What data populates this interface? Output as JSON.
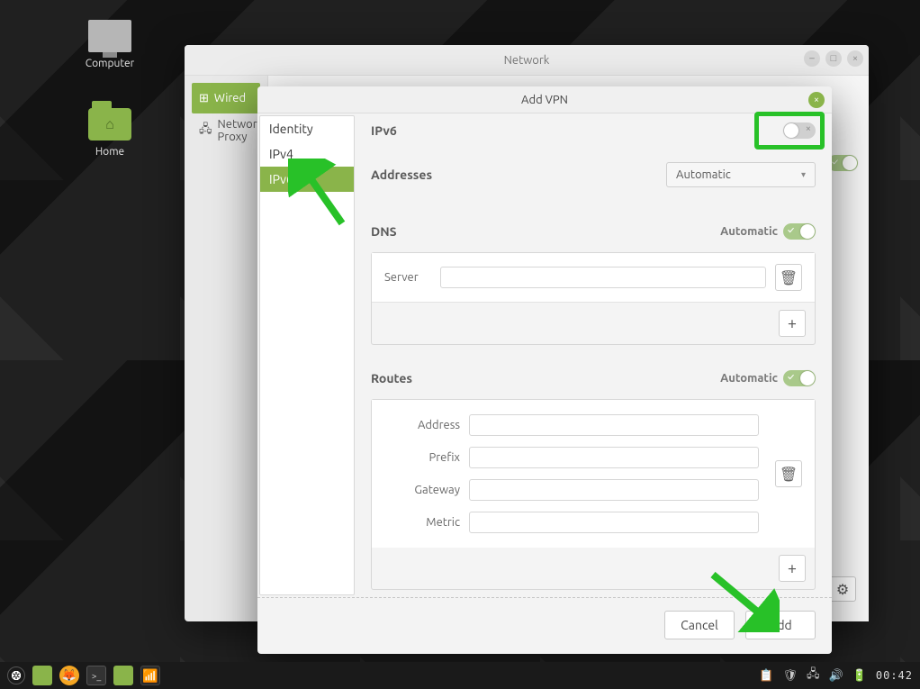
{
  "desktop": {
    "icons": {
      "computer": "Computer",
      "home": "Home"
    }
  },
  "network_window": {
    "title": "Network",
    "sidebar": {
      "wired": {
        "label": "Wired",
        "icon": "network-wired-icon"
      },
      "proxy": {
        "label": "Network Proxy",
        "icon": "network-proxy-icon"
      }
    },
    "add_button": "+",
    "remove_button": "−",
    "gear_button": "⚙"
  },
  "vpn_dialog": {
    "title": "Add VPN",
    "tabs": {
      "identity": "Identity",
      "ipv4": "IPv4",
      "ipv6": "IPv6"
    },
    "selected_tab": "ipv6",
    "ipv6": {
      "heading": "IPv6",
      "enabled": false,
      "addresses": {
        "label": "Addresses",
        "mode": "Automatic"
      },
      "dns": {
        "label": "DNS",
        "automatic_label": "Automatic",
        "automatic": true,
        "server_label": "Server",
        "server_value": "",
        "add": "+"
      },
      "routes": {
        "label": "Routes",
        "automatic_label": "Automatic",
        "automatic": true,
        "fields": {
          "address": "Address",
          "prefix": "Prefix",
          "gateway": "Gateway",
          "metric": "Metric"
        },
        "add": "+"
      }
    },
    "actions": {
      "cancel": "Cancel",
      "add": "Add"
    }
  },
  "taskbar": {
    "clock": "00:42"
  },
  "colors": {
    "accent": "#8ab44a",
    "highlight": "#28c128"
  }
}
